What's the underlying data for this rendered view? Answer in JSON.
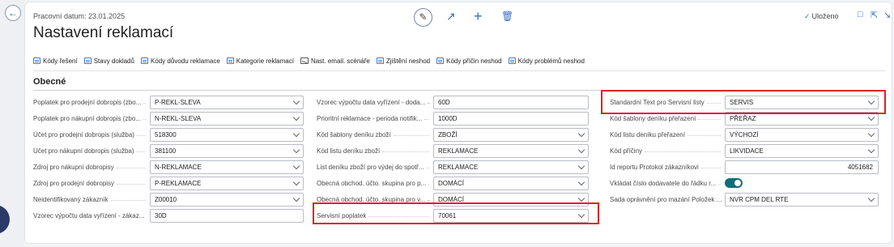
{
  "header": {
    "caption": "Pracovní datum: 23.01.2025",
    "title": "Nastavení reklamací",
    "saved_label": "Uloženo",
    "saved_icon": "check-icon"
  },
  "toolbar_icons": [
    "edit-icon",
    "share-icon",
    "plus-icon",
    "delete-icon"
  ],
  "actions": [
    {
      "label": "Kódy řešení",
      "icon": "table-icon"
    },
    {
      "label": "Stavy dokladů",
      "icon": "table-icon"
    },
    {
      "label": "Kódy důvodu reklamace",
      "icon": "table-icon"
    },
    {
      "label": "Kategorie reklamací",
      "icon": "table-icon"
    },
    {
      "label": "Nast. email. scénáře",
      "icon": "mail-icon"
    },
    {
      "label": "Zjištění neshod",
      "icon": "table-icon"
    },
    {
      "label": "Kódy příčin neshod",
      "icon": "table-icon"
    },
    {
      "label": "Kódy problémů neshod",
      "icon": "table-icon"
    }
  ],
  "section": {
    "title": "Obecné"
  },
  "col1": [
    {
      "label": "Poplatek pro prodejní dobropis (zbo...",
      "value": "P-REKL-SLEVA"
    },
    {
      "label": "Poplatek pro nákupní dobropis (zbo...",
      "value": "N-REKL-SLEVA"
    },
    {
      "label": "Účet pro prodejní dobropis (služba)",
      "value": "518300"
    },
    {
      "label": "Účet pro nákupní dobropis (služba)",
      "value": "381100"
    },
    {
      "label": "Zdroj pro nákupní dobropisy",
      "value": "N-REKLAMACE"
    },
    {
      "label": "Zdroj pro prodejní dobropisy",
      "value": "P-REKLAMACE"
    },
    {
      "label": "Neidentifikovaný zákazník",
      "value": "Z00010"
    },
    {
      "label": "Vzorec výpočtu data vyřízení - zákaz...",
      "value": "30D"
    }
  ],
  "col2": [
    {
      "label": "Vzorec výpočtu data vyřízení - doda...",
      "value": "60D"
    },
    {
      "label": "Prioritní reklamace - perioda notifik...",
      "value": "1000D"
    },
    {
      "label": "Kód šablony deníku zboží",
      "value": "ZBOŽÍ"
    },
    {
      "label": "Kód listu deníku zboží",
      "value": "REKLAMACE"
    },
    {
      "label": "List deníku zboží pro výdej do spotř...",
      "value": "REKLAMACE"
    },
    {
      "label": "Obecná obchod. účto. skupina pro p...",
      "value": "DOMÁCÍ"
    },
    {
      "label": "Obecná obchod. účto. skupina pro v...",
      "value": "DOMÁCÍ"
    },
    {
      "label": "Servisní poplatek",
      "value": "70061"
    }
  ],
  "col3": [
    {
      "label": "Standardní Text pro Servisní listy",
      "value": "SERVIS"
    },
    {
      "label": "Kód šablony deníku přeřazení",
      "value": "PŘEŘAZ"
    },
    {
      "label": "Kód listu deníku přeřazení",
      "value": "VÝCHOZÍ"
    },
    {
      "label": "Kód příčiny",
      "value": "LIKVIDACE"
    },
    {
      "label": "Id reportu Protokol zákazníkovi",
      "value": "4051682"
    },
    {
      "label": "Vkládat číslo dodavatele do řádku r...",
      "value": "true"
    },
    {
      "label": "Sada oprávnění pro mazání Položek ...",
      "value": "NVR CPM DEL RTE"
    }
  ],
  "colors": {
    "highlight": "#e02020",
    "toggle_on": "#0f6e7a",
    "accent": "#3a6fc2"
  }
}
